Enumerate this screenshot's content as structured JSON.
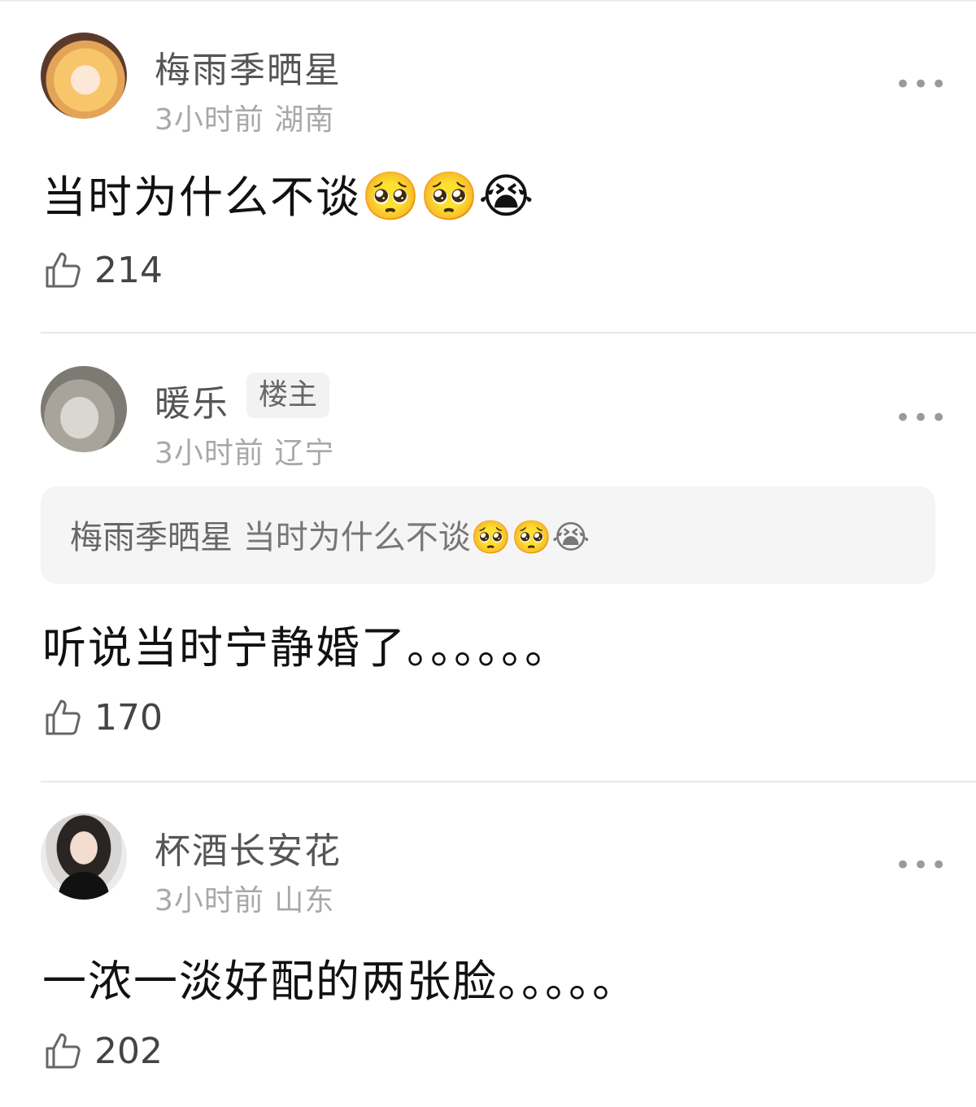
{
  "comments": [
    {
      "author": "梅雨季晒星",
      "time": "3小时前",
      "location": "湖南",
      "text": "当时为什么不谈",
      "emojis": "🥺🥺😭",
      "likes": "214",
      "more_label": "•••"
    },
    {
      "author": "暖乐",
      "badge": "楼主",
      "time": "3小时前",
      "location": "辽宁",
      "quote_author": "梅雨季晒星",
      "quote_text": "当时为什么不谈🥺🥺😭",
      "text": "听说当时宁静婚了。。。。。。",
      "likes": "170",
      "more_label": "•••"
    },
    {
      "author": "杯酒长安花",
      "time": "3小时前",
      "location": "山东",
      "text": "一浓一淡好配的两张脸。。。。。",
      "likes": "202",
      "more_label": "•••"
    }
  ],
  "icons": {
    "like": "thumbs-up-icon",
    "more": "more-dots-icon"
  }
}
